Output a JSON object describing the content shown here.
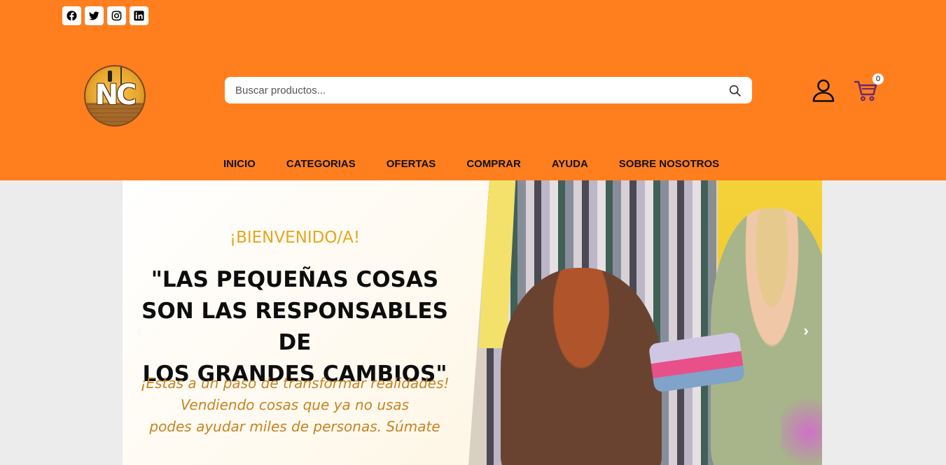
{
  "social": {
    "icons": [
      "facebook-icon",
      "twitter-icon",
      "instagram-icon",
      "linkedin-icon"
    ]
  },
  "header": {
    "background": "#ff7f1f",
    "logo_text": "NC",
    "search": {
      "placeholder": "Buscar productos...",
      "value": ""
    },
    "cart_count": "0"
  },
  "nav": {
    "items": [
      "INICIO",
      "CATEGORIAS",
      "OFERTAS",
      "COMPRAR",
      "AYUDA",
      "SOBRE NOSOTROS"
    ]
  },
  "hero": {
    "welcome": "¡BIENVENIDO/A!",
    "quote_lines": [
      "\"LAS PEQUEÑAS COSAS",
      "SON LAS RESPONSABLES DE",
      "LOS GRANDES CAMBIOS\""
    ],
    "sub_lines": [
      "¡Estas a un paso de transformar realidades!",
      "Vendiendo cosas que ya no usas",
      "podes ayudar miles de personas. Súmate"
    ],
    "prev_arrow": "‹",
    "next_arrow": "›",
    "accent_color": "#e8a51c"
  }
}
